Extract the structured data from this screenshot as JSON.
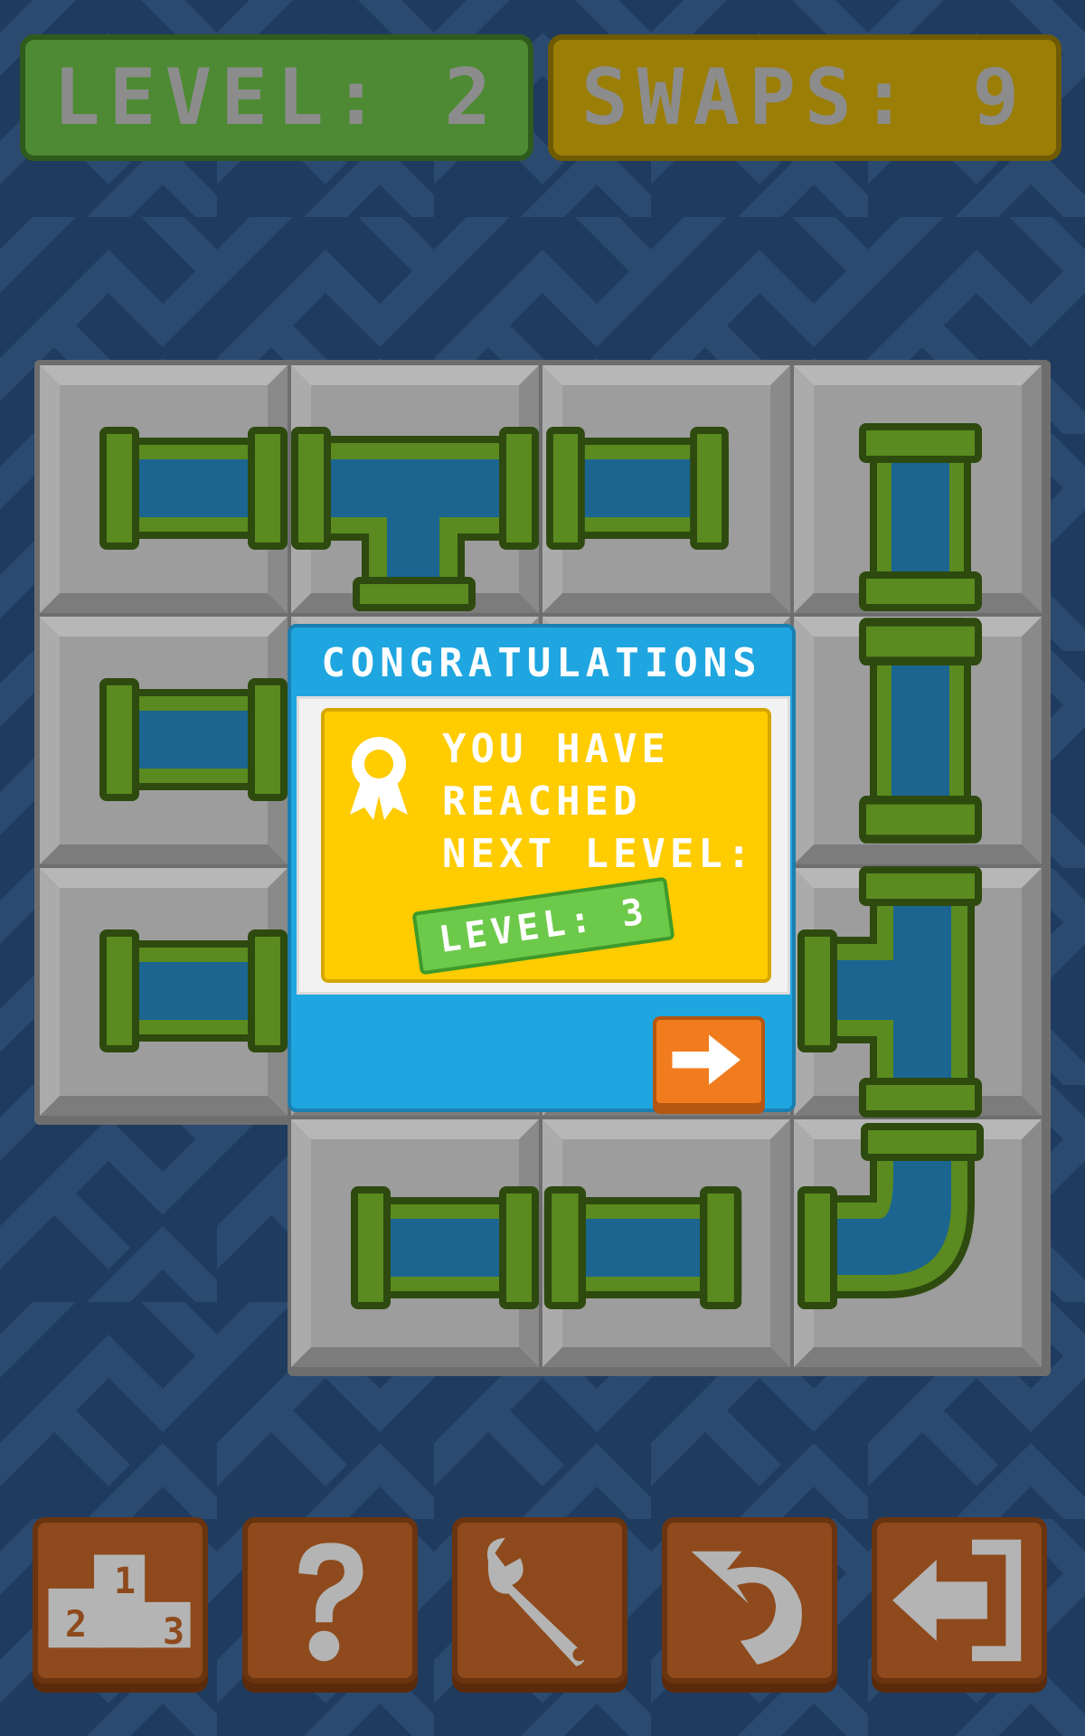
{
  "hud": {
    "level_label": "LEVEL: 2",
    "swaps_label": "SWAPS: 9"
  },
  "dialog": {
    "title": "CONGRATULATIONS",
    "message_lines": [
      "YOU HAVE",
      "REACHED",
      "NEXT LEVEL:"
    ],
    "level_badge": "LEVEL: 3",
    "next_icon": "arrow-right-icon",
    "award_icon": "award-ribbon-icon"
  },
  "toolbar": {
    "leaderboard_icon": "podium-icon",
    "podium_digits": [
      "1",
      "2",
      "3"
    ],
    "help_icon": "question-mark-icon",
    "settings_icon": "wrench-icon",
    "undo_icon": "undo-arrow-icon",
    "exit_icon": "exit-door-icon"
  },
  "colors": {
    "background": "#1f3b5e",
    "level_box": "#4d8a33",
    "swaps_box": "#9b7e06",
    "pipe_green": "#5a8a20",
    "water_blue": "#1b6590",
    "dialog_blue": "#1fa6e0",
    "card_yellow": "#ffcc00",
    "badge_green": "#6dc94a",
    "button_orange": "#f07c1e",
    "toolbar_brown": "#8e4a1c"
  }
}
